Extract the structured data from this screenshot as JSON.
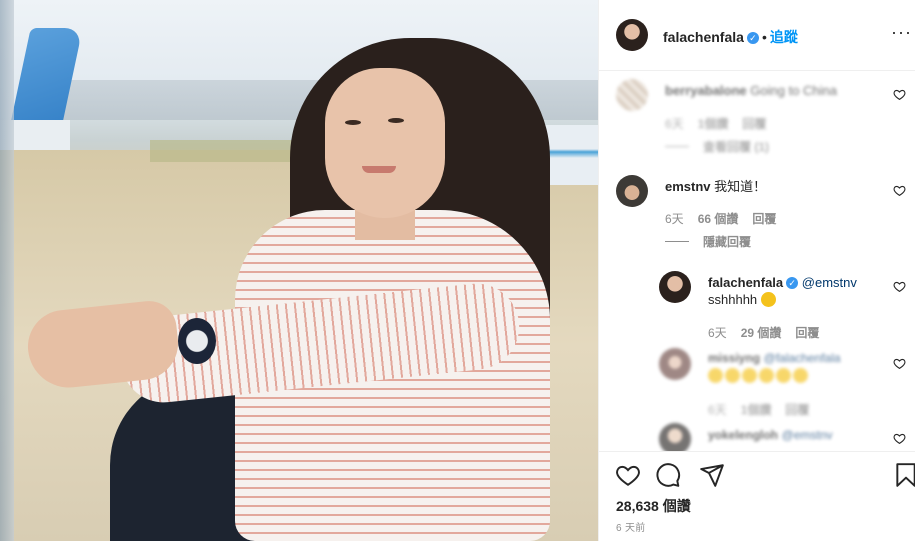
{
  "post": {
    "image_alt": "Photo of woman in striped shirt sitting by airport window",
    "author": "falachenfala",
    "follow_label": "追蹤",
    "more_label": "···"
  },
  "comments": [
    {
      "username": "berryabalone",
      "text": "Going to China",
      "age": "6天",
      "likes": "1個讚",
      "reply": "回覆",
      "view_replies": "查看回覆 (1)"
    },
    {
      "username": "emstnv",
      "text": "我知道！",
      "age": "6天",
      "likes": "66 個讚",
      "reply": "回覆",
      "hide_replies": "隱藏回覆"
    }
  ],
  "replies": [
    {
      "username": "falachenfala",
      "mention": "@emstnv",
      "text": "sshhhhh",
      "age": "6天",
      "likes": "29 個讚",
      "reply": "回覆"
    },
    {
      "username": "missiyng",
      "mention": "@falachenfala",
      "age": "6天",
      "likes": "1個讚",
      "reply": "回覆"
    },
    {
      "username": "yokelengloh",
      "mention": "@emstnv"
    }
  ],
  "footer": {
    "likes": "28,638 個讚",
    "time": "6 天前"
  },
  "icons": [
    "heart-icon",
    "comment-icon",
    "share-icon",
    "bookmark-icon",
    "verified-icon",
    "more-icon"
  ],
  "colors": {
    "follow": "#0095f6",
    "verified": "#3897f0",
    "meta": "#8e8e8e"
  }
}
